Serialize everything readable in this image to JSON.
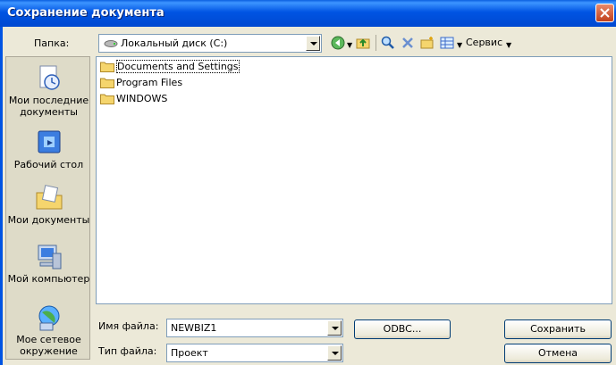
{
  "window": {
    "title": "Сохранение документа"
  },
  "toolbar": {
    "folder_label": "Папка:",
    "location": "Локальный диск (C:)",
    "service_label": "Сервис",
    "icons": [
      "back-icon",
      "up-folder-icon",
      "search-web-icon",
      "delete-icon",
      "new-folder-icon",
      "views-icon"
    ]
  },
  "places": [
    {
      "label": "Мои последние документы",
      "icon": "recent-documents-icon"
    },
    {
      "label": "Рабочий стол",
      "icon": "desktop-icon"
    },
    {
      "label": "Мои документы",
      "icon": "my-documents-icon"
    },
    {
      "label": "Мой компьютер",
      "icon": "my-computer-icon"
    },
    {
      "label": "Мое сетевое окружение",
      "icon": "network-icon"
    }
  ],
  "files": [
    {
      "name": "Documents and Settings",
      "type": "folder"
    },
    {
      "name": "Program Files",
      "type": "folder"
    },
    {
      "name": "WINDOWS",
      "type": "folder"
    }
  ],
  "form": {
    "filename_label": "Имя файла:",
    "filename_value": "NEWBIZ1",
    "filetype_label": "Тип файла:",
    "filetype_value": "Проект",
    "odbc_label": "ODBC...",
    "save_label": "Сохранить",
    "cancel_label": "Отмена"
  },
  "colors": {
    "titlebar": "#0054e3",
    "dialog_bg": "#ece9d8",
    "places_bg": "#dedbc8"
  }
}
